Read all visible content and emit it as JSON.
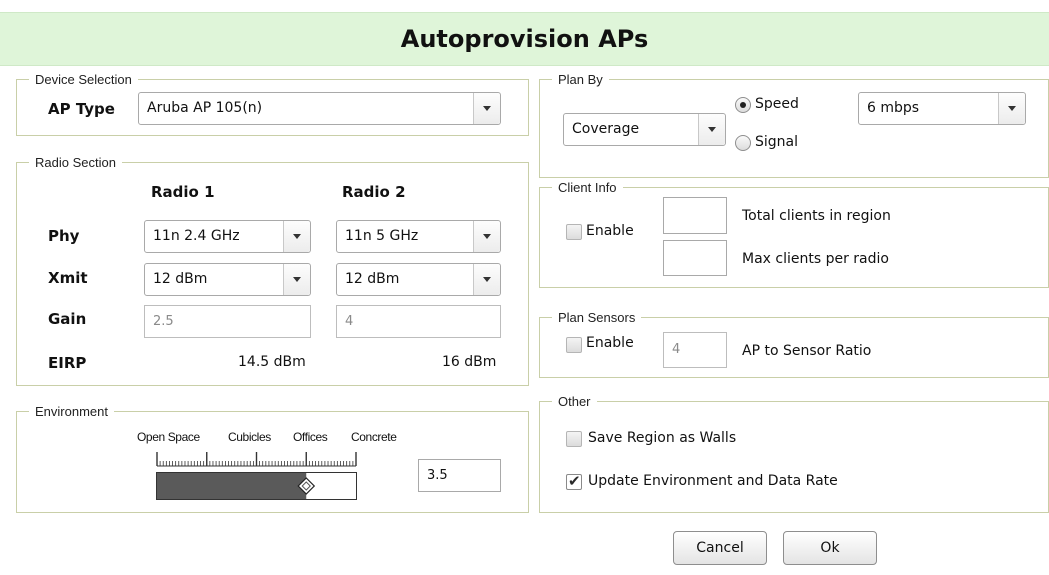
{
  "dialog": {
    "title": "Autoprovision APs"
  },
  "device_selection": {
    "legend": "Device Selection",
    "ap_type_label": "AP Type",
    "ap_type_value": "Aruba AP 105(n)"
  },
  "radio_section": {
    "legend": "Radio Section",
    "radio1_header": "Radio 1",
    "radio2_header": "Radio 2",
    "phy_label": "Phy",
    "xmit_label": "Xmit",
    "gain_label": "Gain",
    "eirp_label": "EIRP",
    "radio1": {
      "phy": "11n 2.4 GHz",
      "xmit": "12 dBm",
      "gain": "2.5",
      "eirp": "14.5 dBm"
    },
    "radio2": {
      "phy": "11n 5 GHz",
      "xmit": "12 dBm",
      "gain": "4",
      "eirp": "16 dBm"
    }
  },
  "environment": {
    "legend": "Environment",
    "ticks": [
      "Open Space",
      "Cubicles",
      "Offices",
      "Concrete"
    ],
    "value": "3.5",
    "slider_fraction": 0.75
  },
  "plan_by": {
    "legend": "Plan By",
    "mode_value": "Coverage",
    "speed_label": "Speed",
    "signal_label": "Signal",
    "selected": "Speed",
    "rate_value": "6 mbps"
  },
  "client_info": {
    "legend": "Client Info",
    "enable_label": "Enable",
    "enabled": false,
    "total_clients_label": "Total clients in region",
    "total_clients_value": "",
    "max_clients_label": "Max clients per radio",
    "max_clients_value": ""
  },
  "plan_sensors": {
    "legend": "Plan Sensors",
    "enable_label": "Enable",
    "enabled": false,
    "ratio_value": "4",
    "ratio_label": "AP to Sensor Ratio"
  },
  "other": {
    "legend": "Other",
    "save_walls_label": "Save Region as Walls",
    "save_walls_checked": false,
    "update_env_label": "Update Environment and Data Rate",
    "update_env_checked": true
  },
  "buttons": {
    "cancel": "Cancel",
    "ok": "Ok"
  },
  "colors": {
    "title_bg": "#dff5d9",
    "group_border": "#c9cfa8",
    "slider_fill": "#5a5a5a"
  }
}
